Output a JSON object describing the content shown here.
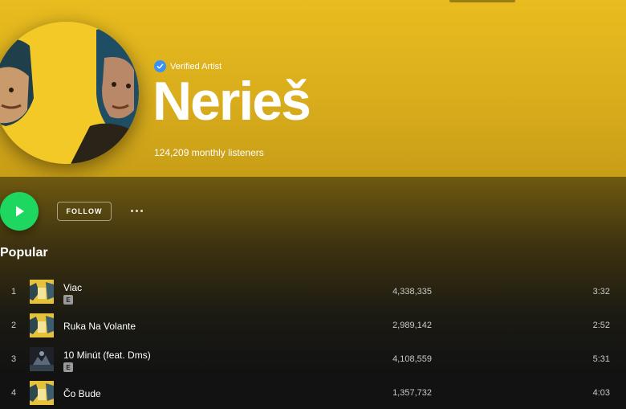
{
  "artist": {
    "verified_label": "Verified Artist",
    "name": "Nerieš",
    "monthly_listeners": "124,209 monthly listeners"
  },
  "actions": {
    "follow_label": "FOLLOW"
  },
  "popular": {
    "title": "Popular",
    "tracks": [
      {
        "num": "1",
        "title": "Viac",
        "explicit": true,
        "plays": "4,338,335",
        "duration": "3:32"
      },
      {
        "num": "2",
        "title": "Ruka Na Volante",
        "explicit": false,
        "plays": "2,989,142",
        "duration": "2:52"
      },
      {
        "num": "3",
        "title": "10 Minút (feat. Dms)",
        "explicit": true,
        "plays": "4,108,559",
        "duration": "5:31"
      },
      {
        "num": "4",
        "title": "Čo Bude",
        "explicit": false,
        "plays": "1,357,732",
        "duration": "4:03"
      }
    ],
    "explicit_badge": "E"
  },
  "colors": {
    "accent_green": "#1ed760",
    "hero_yellow": "#e9bd1f",
    "verified_blue": "#3d91f4"
  },
  "icons": {
    "play": "play-icon",
    "verified": "verified-check-icon",
    "more": "more-options-icon"
  }
}
